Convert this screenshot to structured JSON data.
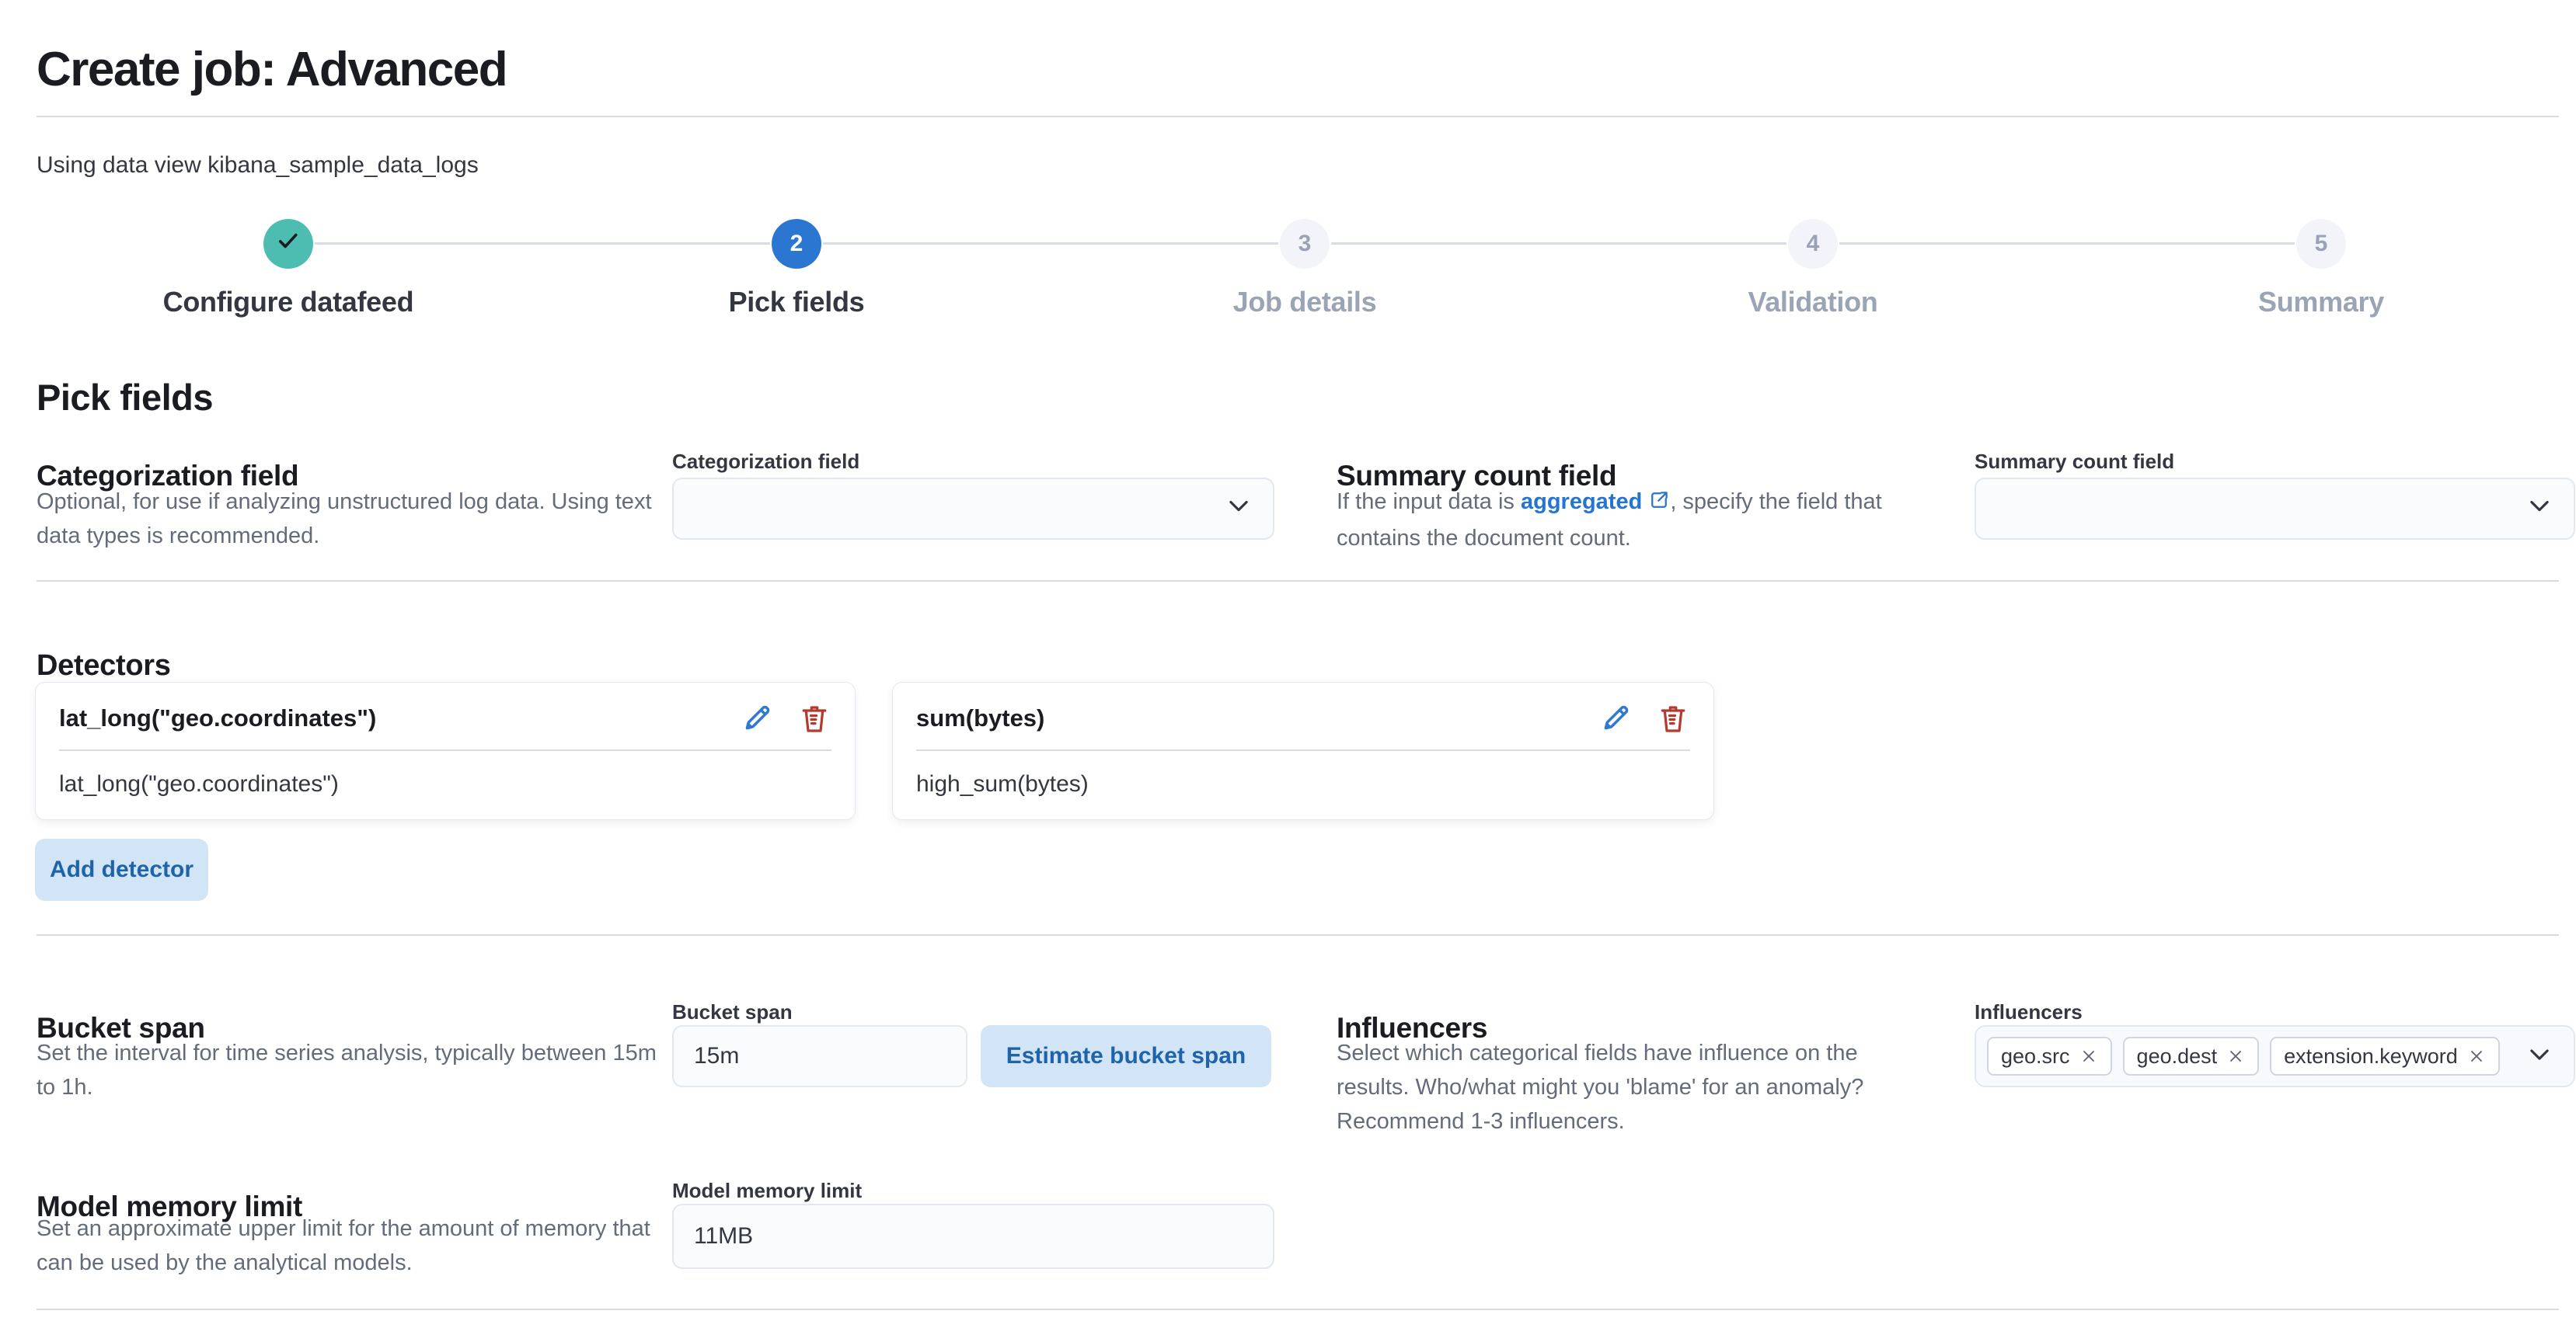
{
  "page": {
    "title": "Create job: Advanced",
    "subtitle": "Using data view kibana_sample_data_logs"
  },
  "steps": [
    {
      "label": "Configure datafeed",
      "state": "complete",
      "icon": "check-icon"
    },
    {
      "number": "2",
      "label": "Pick fields",
      "state": "current"
    },
    {
      "number": "3",
      "label": "Job details",
      "state": "incomplete"
    },
    {
      "number": "4",
      "label": "Validation",
      "state": "incomplete"
    },
    {
      "number": "5",
      "label": "Summary",
      "state": "incomplete"
    }
  ],
  "pick_fields": {
    "heading": "Pick fields"
  },
  "categorization": {
    "heading": "Categorization field",
    "description": "Optional, for use if analyzing unstructured log data. Using text data types is recommended.",
    "label": "Categorization field",
    "value": ""
  },
  "summary_count": {
    "heading": "Summary count field",
    "desc_prefix": "If the input data is ",
    "link_text": "aggregated",
    "desc_suffix": ", specify the field that contains the document count.",
    "label": "Summary count field",
    "value": ""
  },
  "detectors": {
    "heading": "Detectors",
    "cards": [
      {
        "title": "lat_long(\"geo.coordinates\")",
        "description": "lat_long(\"geo.coordinates\")"
      },
      {
        "title": "sum(bytes)",
        "description": "high_sum(bytes)"
      }
    ],
    "add_button": "Add detector"
  },
  "bucket_span": {
    "heading": "Bucket span",
    "description": "Set the interval for time series analysis, typically between 15m to 1h.",
    "label": "Bucket span",
    "value": "15m",
    "estimate_button": "Estimate bucket span"
  },
  "influencers": {
    "heading": "Influencers",
    "description": "Select which categorical fields have influence on the results. Who/what might you 'blame' for an anomaly? Recommend 1-3 influencers.",
    "label": "Influencers",
    "tags": [
      "geo.src",
      "geo.dest",
      "extension.keyword"
    ]
  },
  "model_memory": {
    "heading": "Model memory limit",
    "description": "Set an approximate upper limit for the amount of memory that can be used by the analytical models.",
    "label": "Model memory limit",
    "value": "11MB"
  },
  "colors": {
    "primary_blue": "#2a76d1",
    "success_teal": "#4dbdb2",
    "danger_red": "#b5392d",
    "link_blue": "#2575d0",
    "light_button_bg": "#d1e5f6",
    "light_button_text": "#1f64ab",
    "divider": "#d6dbe4",
    "subdued_text": "#646b79",
    "inactive_step": "#9aa4b5",
    "control_bg": "#f9fbfd"
  }
}
